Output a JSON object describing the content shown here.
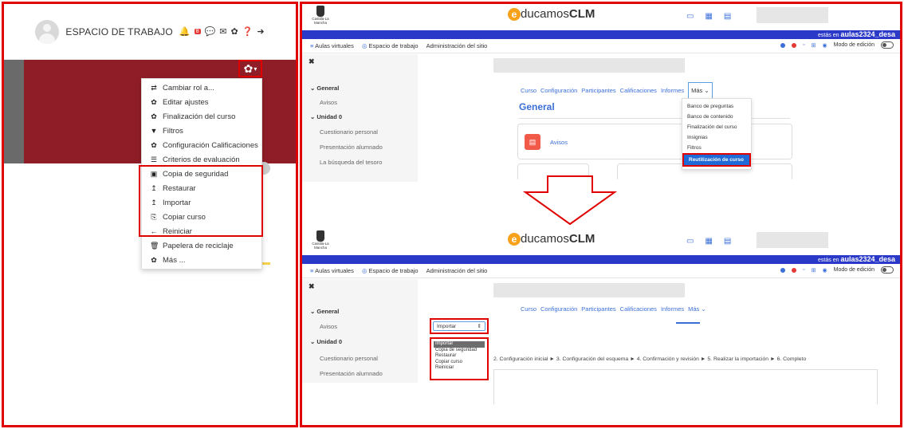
{
  "left": {
    "workspace_title": "ESPACIO DE TRABAJO",
    "notification_count": "8",
    "menu": [
      {
        "icon": "⇄",
        "label": "Cambiar rol a..."
      },
      {
        "icon": "✿",
        "label": "Editar ajustes"
      },
      {
        "icon": "✿",
        "label": "Finalización del curso"
      },
      {
        "icon": "▼",
        "label": "Filtros"
      },
      {
        "icon": "✿",
        "label": "Configuración Calificaciones"
      },
      {
        "icon": "☰",
        "label": "Criterios de evaluación"
      },
      {
        "icon": "▣",
        "label": "Copia de seguridad"
      },
      {
        "icon": "↥",
        "label": "Restaurar"
      },
      {
        "icon": "↥",
        "label": "Importar"
      },
      {
        "icon": "⎘",
        "label": "Copiar curso"
      },
      {
        "icon": "←",
        "label": "Reiniciar"
      },
      {
        "icon": "🗑",
        "label": "Papelera de reciclaje"
      },
      {
        "icon": "✿",
        "label": "Más ..."
      }
    ]
  },
  "brand": {
    "region": "Castilla-La Mancha",
    "logo_e": "e",
    "logo_mid": "ducamos",
    "logo_end": "CLM",
    "bar_prefix": "estás en ",
    "bar_site": "aulas2324_desa"
  },
  "nav": {
    "item1": "Aulas virtuales",
    "item2": "Espacio de trabajo",
    "item3": "Administración del sitio",
    "edit_mode": "Modo de edición"
  },
  "drawer": {
    "close": "✖",
    "general": "General",
    "avisos": "Avisos",
    "unidad": "Unidad 0",
    "cuestionario": "Cuestionario personal",
    "presentacion": "Presentación alumnado",
    "busqueda": "La búsqueda del tesoro"
  },
  "tabs": {
    "curso": "Curso",
    "config": "Configuración",
    "participantes": "Participantes",
    "calificaciones": "Calificaciones",
    "informes": "Informes",
    "mas": "Más"
  },
  "course": {
    "section_title": "General",
    "avisos_label": "Avisos"
  },
  "more_menu": [
    "Banco de preguntas",
    "Banco de contenido",
    "Finalización del curso",
    "Insignias",
    "Filtros",
    "Reutilización de curso"
  ],
  "import": {
    "selected": "Importar",
    "options": [
      "Importar",
      "Copia de seguridad",
      "Restaurar",
      "Copiar curso",
      "Reiniciar"
    ],
    "steps": "2. Configuración inicial ► 3. Configuración del esquema ► 4. Confirmación y revisión ► 5. Realizar la importación ► 6. Completo"
  },
  "colors": {
    "highlight": "#e00000",
    "primary": "#3b6fd8",
    "bar": "#2a39c7",
    "banner": "#8f1d28"
  }
}
